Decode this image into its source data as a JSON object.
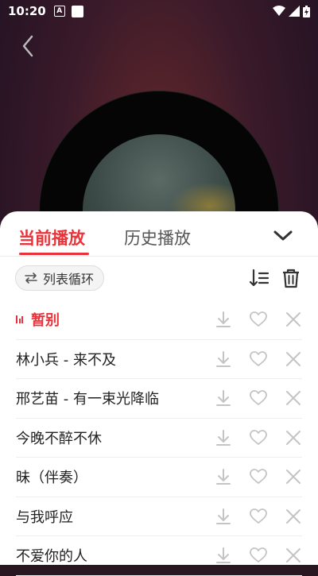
{
  "status_bar": {
    "time": "10:20",
    "notif_icon_letter": "A"
  },
  "player": {
    "back_icon": "chevron-left-icon"
  },
  "playlist": {
    "tabs": [
      {
        "label": "当前播放",
        "active": true
      },
      {
        "label": "历史播放",
        "active": false
      }
    ],
    "mode_label": "列表循环",
    "accent_color": "#e8333a",
    "songs": [
      {
        "title": "暂别",
        "playing": true
      },
      {
        "title": "林小兵 - 来不及",
        "playing": false
      },
      {
        "title": "邢艺苗 - 有一束光降临",
        "playing": false
      },
      {
        "title": "今晚不醉不休",
        "playing": false
      },
      {
        "title": "昧（伴奏）",
        "playing": false
      },
      {
        "title": "与我呼应",
        "playing": false
      },
      {
        "title": "不爱你的人",
        "playing": false
      }
    ]
  }
}
